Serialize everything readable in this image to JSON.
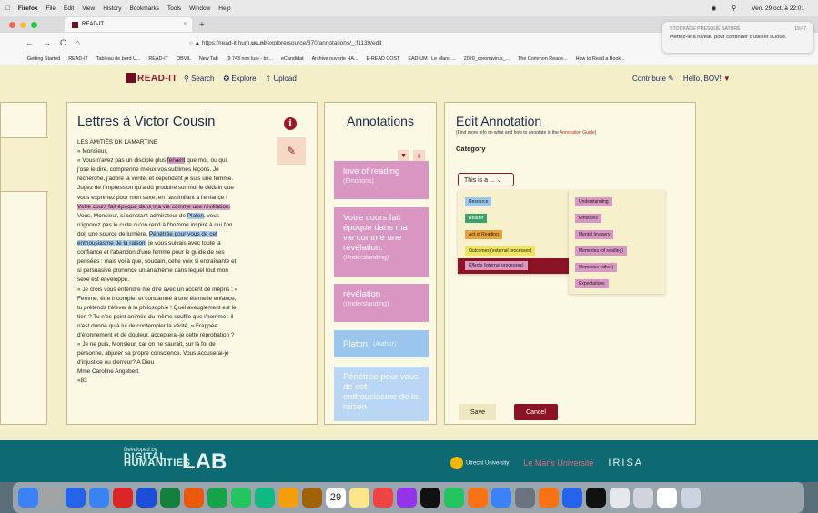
{
  "mac_menubar": {
    "app": "Firefox",
    "items": [
      "File",
      "Edit",
      "View",
      "History",
      "Bookmarks",
      "Tools",
      "Window",
      "Help"
    ],
    "clock": "Ven. 29 oct. à 22:01"
  },
  "browser": {
    "tab_title": "READ-IT",
    "url_prefix": "https://read-it.hum.",
    "url_domain": "uu.nl",
    "url_path": "/explore/source/370/annotations/_:f1139/edit",
    "bookmarks": [
      "Getting Started",
      "READ-IT",
      "Tableau de bord U...",
      "READ-IT",
      "OBVIL",
      "New Tab",
      "(9 743 non lus) - bri...",
      "eCandidat",
      "Archive ouverte HA...",
      "E-READ COST",
      "EAD-UM : Le Mans ...",
      "2020_coronavirus_...",
      "The Common Reade...",
      "How to Read a Book..."
    ]
  },
  "notification": {
    "title": "STOCKAGE PRESQUE SATURÉ",
    "time": "19:47",
    "body": "Mettez-le à niveau pour continuer d'utiliser iCloud."
  },
  "header": {
    "logo": "READ-IT",
    "search": "Search",
    "explore": "Explore",
    "upload": "Upload",
    "contribute": "Contribute",
    "user": "Hello, BOV!"
  },
  "document": {
    "title": "Lettres à Victor Cousin",
    "info_icon": "info-circle-icon",
    "pen_icon": "highlighter-icon",
    "lines": {
      "l1": "LES AMITIÉS DK LAMARTINE",
      "l2": "« Monsieur,",
      "l3a": "« Vous n'avez pas un disciple plus ",
      "l3b": "fervent",
      "l3c": " que  moi, ou qui,",
      "l4": "j'ose le dire, comprenne mieux vos  sublimes leçons. Je",
      "l5": "recherche, j'adore la vérité, et  cependant je suis une femme.",
      "l6": "Jugez de l'impression qu'a dû produire sur moi le dédain que",
      "l7": "vous  exprimez pour mon sexe, en l'assimilant à l'enfance !",
      "l8": "Votre cours fait époque dans ma vie comme une  révélation.",
      "l9a": "Vous, Monsieur, si constant admirateur  de ",
      "l9b": "Platon",
      "l9c": ", vous",
      "l10": "n'ignorez pas le culte qu'on rend à  l'homme inspiré à qui l'on",
      "l11a": "doit une source de lumière.  ",
      "l11b": "Pénétrée pour vous de cet",
      "l12a": "enthousiasme de la raison",
      "l12b": ", je vous suivais avec toute la",
      "l13": "confiance et  l'abandon d'une femme pour le guide de ses",
      "l14": "pensées : mais voilà que, soudain, cette voix si entraînante et",
      "l15": "si persuasive prononce un anathème dans  lequel tout mon",
      "l16": "sexe est enveloppé.",
      "l17": "« Je crois vous entendre me dire avec un accent  de mépris : «",
      "l18": "Femme, être incomplet et condamné  à une éternelle enfance,",
      "l19": "tu prétends t'élever à la  philosophie ! Quel aveuglement est le",
      "l20": "tien ? Tu  n'es point animée du même souffle que l'homme : il",
      "l21": "n'est donné qu'à lui de contempler la vérité, »  Frappée",
      "l22": "d'étonnement et de douleur, accepterai-je  cette réprobation ?",
      "l23": "« Je ne puis, Monsieur, car on ne saurait, sur la  foi de",
      "l24": "personne, abjurer sa propre conscience.  Vous accuserai-je",
      "l25": "d'injustice ou d'erreur? A Dieu",
      "l26": "Mme Caroline Angebert.",
      "l27": "«83"
    }
  },
  "annotations": {
    "title": "Annotations",
    "cards": [
      {
        "text": "love of reading",
        "cat": "(Emotions)"
      },
      {
        "text": "Votre cours fait époque dans ma vie comme une révélation.",
        "cat": "(Understanding)"
      },
      {
        "text": "révélation",
        "cat": "(Understanding)"
      },
      {
        "text": "Platon",
        "cat": "(Author)"
      },
      {
        "text": "Pénétrée pour vous de cet enthousiasme de la raison",
        "cat": ""
      }
    ]
  },
  "edit": {
    "title": "Edit Annotation",
    "hint": "(Find more info on what and how to annotate in the ",
    "hint_link": "Annotation Guide",
    "hint_end": ")",
    "category_label": "Category",
    "select_value": "This is a ...",
    "dropdown": [
      "Resource",
      "Reader",
      "Act of Reading",
      "Outcomes (external processes)",
      "Effects (internal processes)"
    ],
    "submenu": [
      "Understanding",
      "Emotions",
      "Mental Imagery",
      "Memories (of reading)",
      "Memories (other)",
      "Expectations"
    ],
    "save": "Save",
    "cancel": "Cancel"
  },
  "footer": {
    "developed_by": "Developed by",
    "digital": "DIGITAL",
    "humanities": "HUMANITIES",
    "lab": "LAB",
    "partners": [
      "Utrecht University",
      "Le Mans Université",
      "IRISA"
    ]
  },
  "dock": {
    "calendar_day": "29"
  },
  "colors": {
    "accent": "#8a1424",
    "pink": "#d996c2",
    "blue": "#a9cdf0",
    "footer": "#0d6a73",
    "panel": "#fbf8e3",
    "page": "#f4efc9"
  }
}
